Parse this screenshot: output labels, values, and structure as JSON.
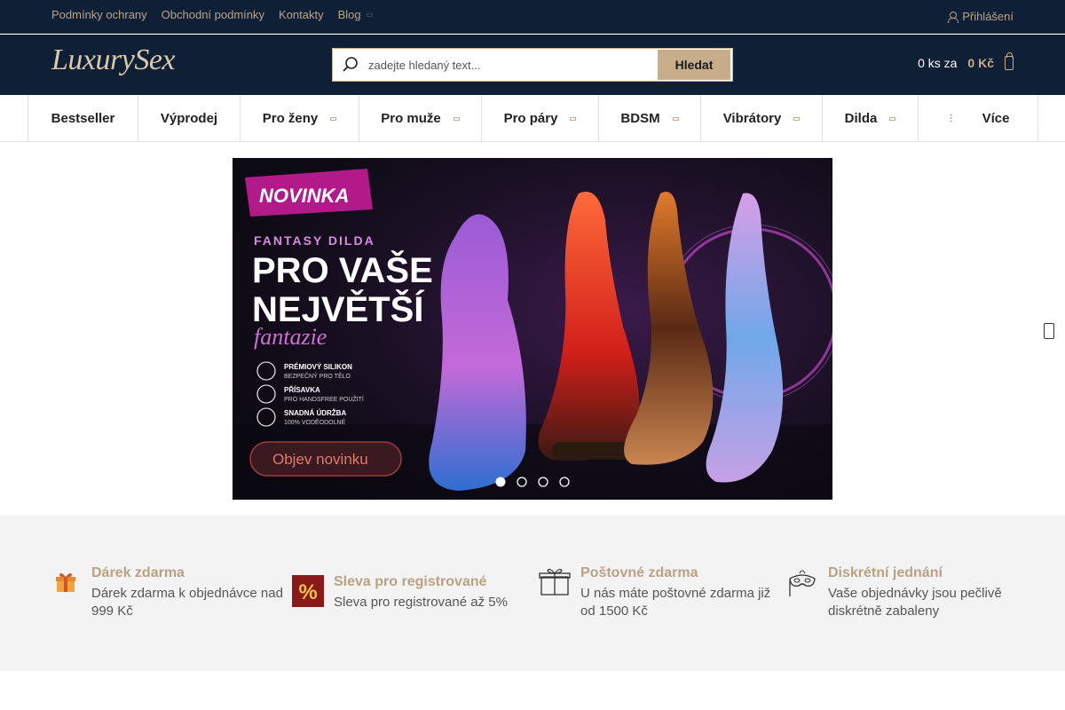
{
  "topbar": {
    "links": [
      {
        "label": "Podmínky ochrany"
      },
      {
        "label": "Obchodní podmínky"
      },
      {
        "label": "Kontakty"
      },
      {
        "label": "Blog"
      }
    ],
    "login": "Přihlášení"
  },
  "header": {
    "logo": "LuxurySex",
    "search_placeholder": "zadejte hledaný text...",
    "search_button": "Hledat",
    "cart_count": "0 ks za",
    "cart_price": "0 Kč"
  },
  "nav": {
    "items": [
      {
        "label": "Bestseller"
      },
      {
        "label": "Výprodej"
      },
      {
        "label": "Pro ženy"
      },
      {
        "label": "Pro muže"
      },
      {
        "label": "Pro páry"
      },
      {
        "label": "BDSM"
      },
      {
        "label": "Vibrátory"
      },
      {
        "label": "Dilda"
      },
      {
        "label": "Více"
      }
    ]
  },
  "banner": {
    "badge": "NOVINKA",
    "kicker": "FANTASY DILDA",
    "headline1": "PRO VAŠE",
    "headline2": "NEJVĚTŠÍ",
    "script": "fantazie",
    "features": [
      {
        "line1": "PRÉMIOVÝ SILIKON",
        "line2": "BEZPEČNÝ PRO TĚLO"
      },
      {
        "line1": "PŘÍSAVKA",
        "line2": "PRO HANDSFREE POUŽITÍ"
      },
      {
        "line1": "SNADNÁ ÚDRŽBA",
        "line2": "100% VODĚODOLNÉ"
      }
    ],
    "cta": "Objev novinku",
    "slides_total": 4,
    "active_slide": 1
  },
  "benefits": [
    {
      "title": "Dárek zdarma",
      "text": "Dárek zdarma k objednávce nad 999 Kč",
      "icon": "gift-icon"
    },
    {
      "title": "Sleva pro registrované",
      "text": "Sleva pro registrované až 5%",
      "icon": "percent-icon"
    },
    {
      "title": "Poštovné zdarma",
      "text": "U nás máte poštovné zdarma již od 1500 Kč",
      "icon": "package-icon"
    },
    {
      "title": "Diskrétní jednání",
      "text": "Vaše objednávky jsou pečlivě diskrétně zabaleny",
      "icon": "mask-icon"
    }
  ],
  "colors": {
    "dark_navy": "#0f1f35",
    "gold": "#c8ad8a",
    "benefit_title": "#b9a282"
  }
}
